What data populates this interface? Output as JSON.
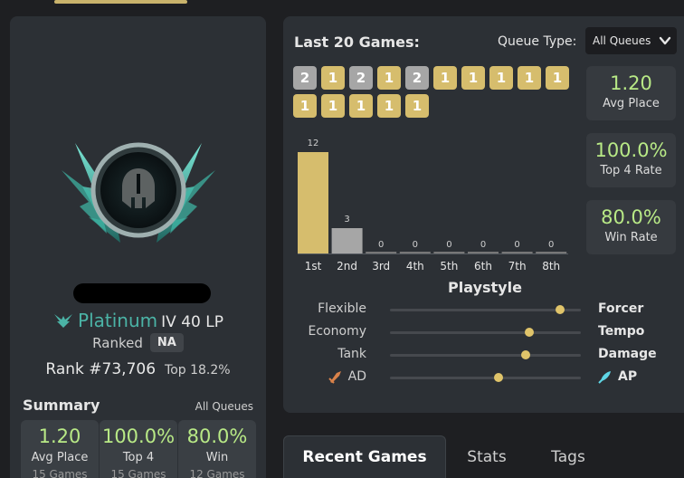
{
  "profile": {
    "tier": "Platinum",
    "division_lp": "IV 40 LP",
    "ranked_label": "Ranked",
    "region": "NA",
    "rank": "Rank #73,706",
    "top_percent": "Top 18.2%",
    "summary": {
      "title": "Summary",
      "queue": "All Queues",
      "cards": [
        {
          "value": "1.20",
          "label": "Avg Place",
          "sub": "15 Games"
        },
        {
          "value": "100.0%",
          "label": "Top 4",
          "sub": "15 Games"
        },
        {
          "value": "80.0%",
          "label": "Win",
          "sub": "12 Games"
        }
      ]
    }
  },
  "games": {
    "title": "Last 20 Games:",
    "queue_label": "Queue Type:",
    "queue_value": "All Queues",
    "placements": [
      {
        "place": "2",
        "kind": "silver"
      },
      {
        "place": "1",
        "kind": "gold"
      },
      {
        "place": "2",
        "kind": "silver"
      },
      {
        "place": "1",
        "kind": "gold"
      },
      {
        "place": "2",
        "kind": "silver"
      },
      {
        "place": "1",
        "kind": "gold"
      },
      {
        "place": "1",
        "kind": "gold"
      },
      {
        "place": "1",
        "kind": "gold"
      },
      {
        "place": "1",
        "kind": "gold"
      },
      {
        "place": "1",
        "kind": "gold"
      },
      {
        "place": "1",
        "kind": "gold"
      },
      {
        "place": "1",
        "kind": "gold"
      },
      {
        "place": "1",
        "kind": "gold"
      },
      {
        "place": "1",
        "kind": "gold"
      },
      {
        "place": "1",
        "kind": "gold"
      }
    ],
    "stats": [
      {
        "value": "1.20",
        "label": "Avg Place"
      },
      {
        "value": "100.0%",
        "label": "Top 4 Rate"
      },
      {
        "value": "80.0%",
        "label": "Win Rate"
      }
    ]
  },
  "chart_data": {
    "type": "bar",
    "categories": [
      "1st",
      "2nd",
      "3rd",
      "4th",
      "5th",
      "6th",
      "7th",
      "8th"
    ],
    "values": [
      12,
      3,
      0,
      0,
      0,
      0,
      0,
      0
    ],
    "colors": [
      "#d6bd6d",
      "#a6a6a6",
      "#777777",
      "#777777",
      "#777777",
      "#777777",
      "#777777",
      "#777777"
    ],
    "ylim": [
      0,
      12
    ],
    "grid": false
  },
  "playstyle": {
    "title": "Playstyle",
    "rows": [
      {
        "left": "Flexible",
        "right": "Forcer",
        "level": 0.89
      },
      {
        "left": "Economy",
        "right": "Tempo",
        "level": 0.73
      },
      {
        "left": "Tank",
        "right": "Damage",
        "level": 0.71
      },
      {
        "left": "AD",
        "right": "AP",
        "level": 0.57,
        "left_icon": "ad-icon",
        "right_icon": "ap-icon"
      }
    ]
  },
  "tabs": [
    {
      "label": "Recent Games",
      "active": true
    },
    {
      "label": "Stats",
      "active": false
    },
    {
      "label": "Tags",
      "active": false
    }
  ],
  "colors": {
    "accent_green": "#b8e986",
    "tier_teal": "#4bb3a6",
    "gold": "#d6bd6d",
    "silver": "#a6a6a6",
    "panel": "#2c3035",
    "background": "#1e1f22"
  }
}
